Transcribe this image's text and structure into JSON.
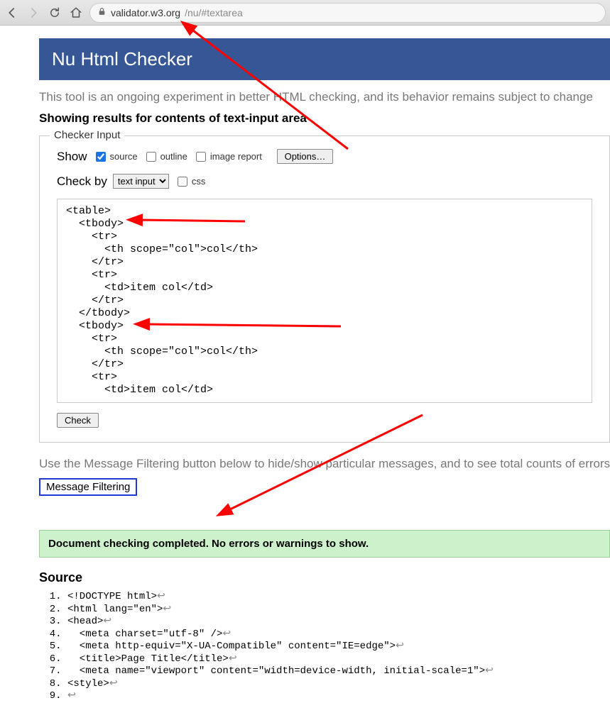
{
  "browser": {
    "url_host": "validator.w3.org",
    "url_path": "/nu/#textarea"
  },
  "banner": {
    "title": "Nu Html Checker"
  },
  "intro": "This tool is an ongoing experiment in better HTML checking, and its behavior remains subject to change",
  "subheading": "Showing results for contents of text-input area",
  "fieldset": {
    "legend": "Checker Input",
    "show_label": "Show",
    "cb_source": "source",
    "cb_outline": "outline",
    "cb_image": "image report",
    "options_btn": "Options…",
    "checkby_label": "Check by",
    "checkby_value": "text input",
    "cb_css": "css",
    "check_btn": "Check",
    "code": "<table>\n  <tbody>\n    <tr>\n      <th scope=\"col\">col</th>\n    </tr>\n    <tr>\n      <td>item col</td>\n    </tr>\n  </tbody>\n  <tbody>\n    <tr>\n      <th scope=\"col\">col</th>\n    </tr>\n    <tr>\n      <td>item col</td>"
  },
  "filter": {
    "text": "Use the Message Filtering button below to hide/show particular messages, and to see total counts of errors and w",
    "button": "Message Filtering"
  },
  "success": "Document checking completed. No errors or warnings to show.",
  "source": {
    "heading": "Source",
    "lines": [
      "<!DOCTYPE html>",
      "<html lang=\"en\">",
      "<head>",
      "  <meta charset=\"utf-8\" />",
      "  <meta http-equiv=\"X-UA-Compatible\" content=\"IE=edge\">",
      "  <title>Page Title</title>",
      "  <meta name=\"viewport\" content=\"width=device-width, initial-scale=1\">",
      "<style>",
      ""
    ]
  }
}
